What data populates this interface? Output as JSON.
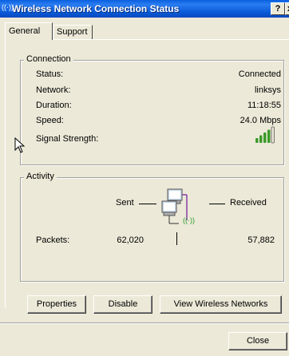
{
  "window": {
    "title": "Wireless Network Connection Status",
    "help_label": "?",
    "close_label": "x"
  },
  "tabs": {
    "general": "General",
    "support": "Support"
  },
  "connection": {
    "heading": "Connection",
    "status_label": "Status:",
    "status_value": "Connected",
    "network_label": "Network:",
    "network_value": "linksys",
    "duration_label": "Duration:",
    "duration_value": "11:18:55",
    "speed_label": "Speed:",
    "speed_value": "24.0 Mbps",
    "signal_label": "Signal Strength:",
    "signal_bars": 4,
    "signal_color": "#3c9a2a"
  },
  "activity": {
    "heading": "Activity",
    "sent_label": "Sent",
    "received_label": "Received",
    "packets_label": "Packets:",
    "packets_sent": "62,020",
    "packets_received": "57,882"
  },
  "buttons": {
    "properties": "Properties",
    "disable": "Disable",
    "view_wireless": "View Wireless Networks",
    "close": "Close"
  }
}
